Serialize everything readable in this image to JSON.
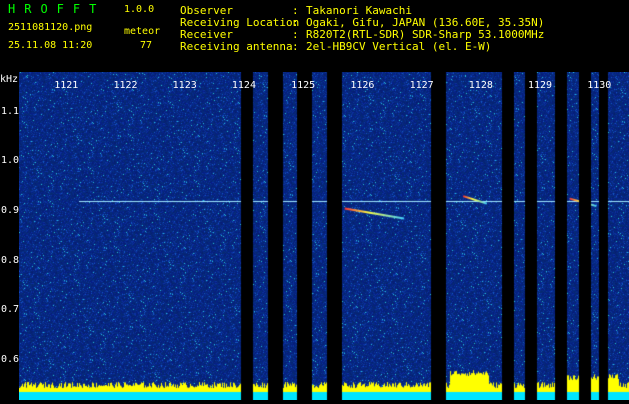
{
  "header": {
    "app_title": "HROFFT",
    "app_version": "1.0.0",
    "file_name": "2511081120.png",
    "datetime": "25.11.08 11:20",
    "meteor_label": "meteor",
    "meteor_count": "77"
  },
  "info": [
    {
      "key": "Observer",
      "colon": ":",
      "value": "Takanori Kawachi"
    },
    {
      "key": "Receiving Location",
      "colon": ":",
      "value": "Ogaki, Gifu, JAPAN (136.60E, 35.35N)"
    },
    {
      "key": "Receiver",
      "colon": ":",
      "value": "R820T2(RTL-SDR) SDR-Sharp 53.1000MHz"
    },
    {
      "key": "Receiving antenna",
      "colon": ":",
      "value": "2el-HB9CV Vertical (el. E-W)"
    }
  ],
  "colors": {
    "title": "#00ff00",
    "text": "#ffff00",
    "axis": "#ffffff",
    "background": "#061f7a",
    "gap": "#000000"
  },
  "chart_data": {
    "type": "heatmap",
    "ylabel": "kHz",
    "yticks": [
      "1.1",
      "1.0",
      "0.9",
      "0.8",
      "0.7",
      "0.6"
    ],
    "y_values": [
      1.1,
      1.0,
      0.9,
      0.8,
      0.7,
      0.6
    ],
    "ylim": [
      0.58,
      1.18
    ],
    "xticks": [
      "1121",
      "1122",
      "1123",
      "1124",
      "1125",
      "1126",
      "1127",
      "1128",
      "1129",
      "1130"
    ],
    "x_minutes": [
      1121,
      1122,
      1123,
      1124,
      1125,
      1126,
      1127,
      1128,
      1129,
      1130
    ],
    "xlim": [
      1120,
      1130.3
    ],
    "carrier_khz": 0.92,
    "gaps_minutes": [
      [
        1123.75,
        1123.95
      ],
      [
        1124.2,
        1124.45
      ],
      [
        1124.7,
        1124.95
      ],
      [
        1125.2,
        1125.45
      ],
      [
        1126.95,
        1127.2
      ],
      [
        1128.15,
        1128.35
      ],
      [
        1128.55,
        1128.75
      ],
      [
        1129.05,
        1129.25
      ],
      [
        1129.45,
        1129.65
      ],
      [
        1129.8,
        1129.95
      ]
    ],
    "meteor_echoes": [
      {
        "start": [
          1125.5,
          0.905
        ],
        "end": [
          1126.5,
          0.885
        ]
      },
      {
        "start": [
          1127.5,
          0.93
        ],
        "end": [
          1127.9,
          0.915
        ]
      },
      {
        "start": [
          1129.3,
          0.925
        ],
        "end": [
          1129.75,
          0.91
        ]
      }
    ]
  }
}
